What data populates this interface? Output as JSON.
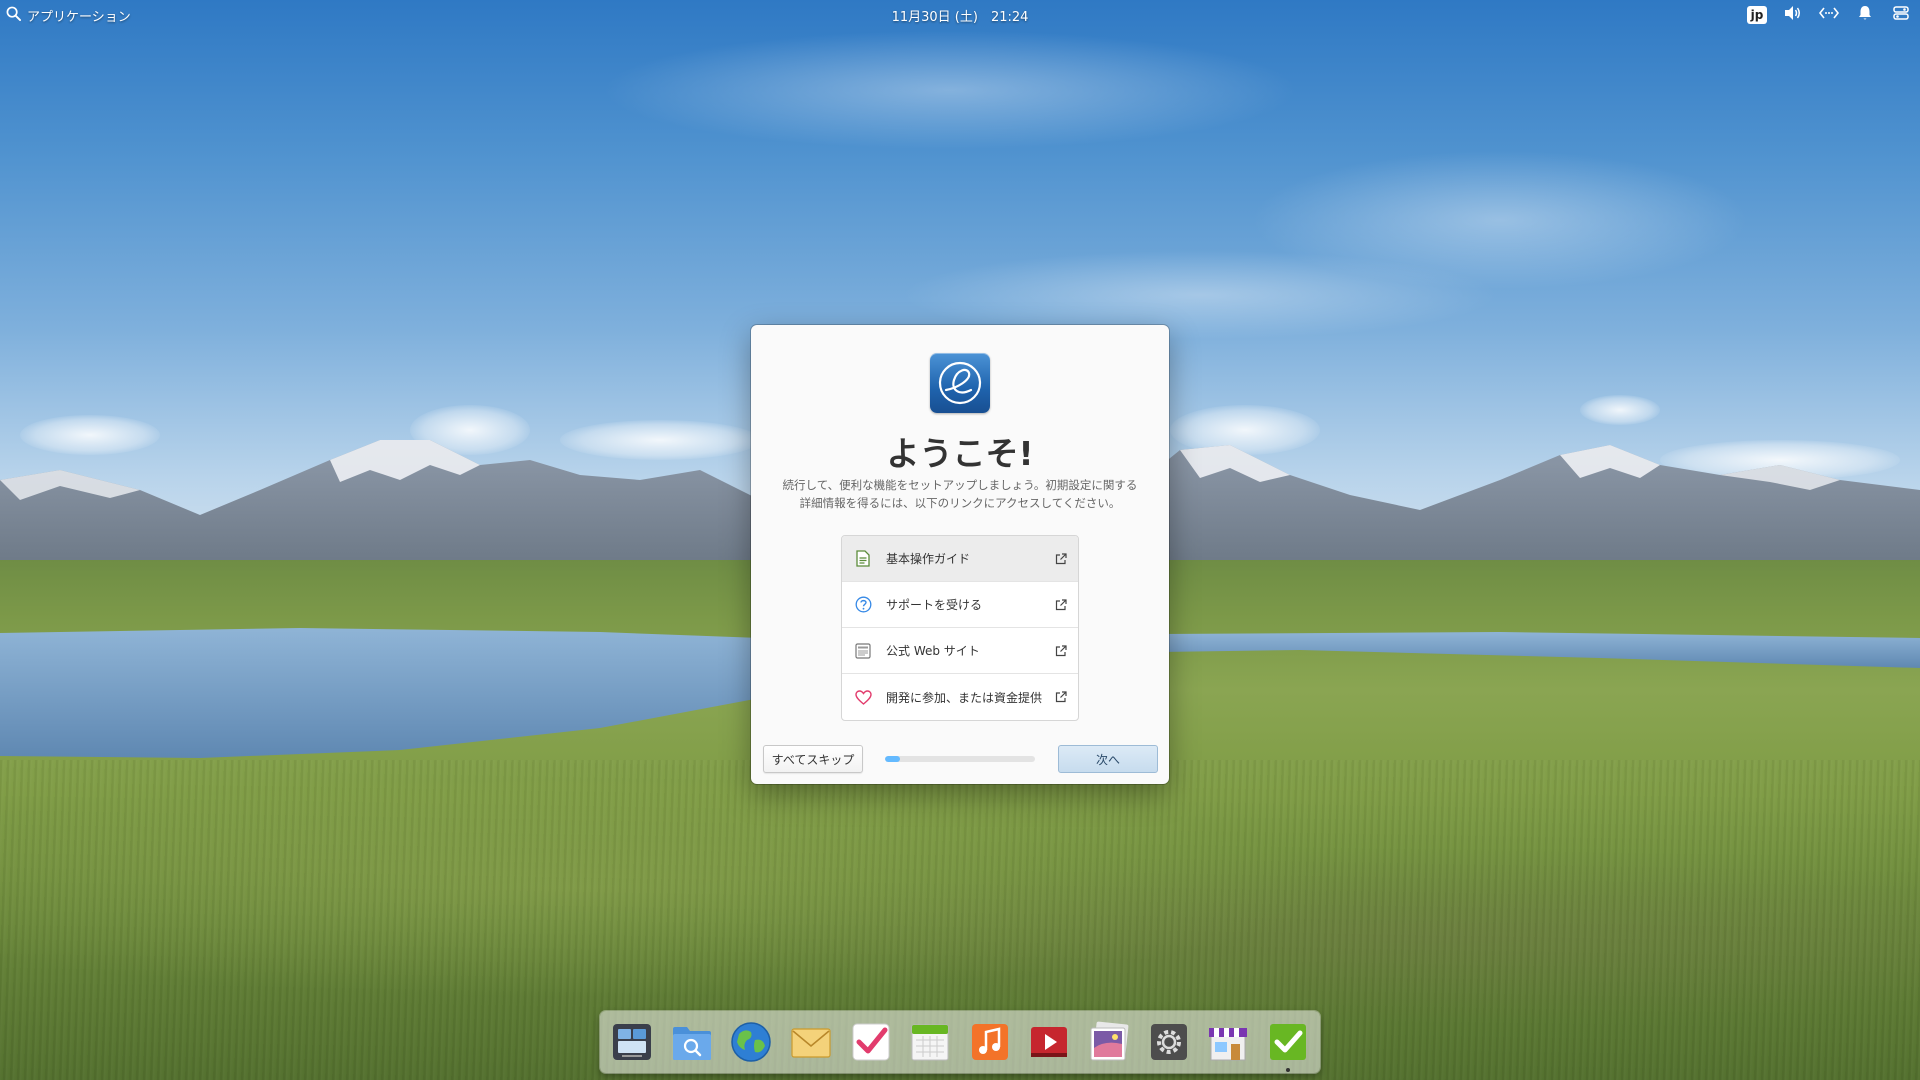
{
  "top_panel": {
    "apps_label": "アプリケーション",
    "clock": "11月30日 (土)　21:24",
    "keyboard_layout": "jp"
  },
  "dialog": {
    "title": "ようこそ!",
    "description": "続行して、便利な機能をセットアップしましょう。初期設定に関する詳細情報を得るには、以下のリンクにアクセスしてください。",
    "links": [
      {
        "label": "基本操作ガイド",
        "icon": "document-icon"
      },
      {
        "label": "サポートを受ける",
        "icon": "help-icon"
      },
      {
        "label": "公式 Web サイト",
        "icon": "website-icon"
      },
      {
        "label": "開発に参加、または資金提供",
        "icon": "heart-icon"
      }
    ],
    "skip_label": "すべてスキップ",
    "next_label": "次へ",
    "progress": 0.1
  },
  "dock": {
    "items": [
      {
        "name": "multitasking-view-icon"
      },
      {
        "name": "files-icon"
      },
      {
        "name": "web-browser-icon"
      },
      {
        "name": "mail-icon"
      },
      {
        "name": "tasks-icon"
      },
      {
        "name": "calendar-icon"
      },
      {
        "name": "music-icon"
      },
      {
        "name": "videos-icon"
      },
      {
        "name": "photos-icon"
      },
      {
        "name": "system-settings-icon"
      },
      {
        "name": "appcenter-icon"
      },
      {
        "name": "initial-setup-icon",
        "running": true
      }
    ]
  },
  "colors": {
    "accent": "#64baff",
    "dialog_bg": "#fafafa",
    "heart": "#e23c6d"
  }
}
